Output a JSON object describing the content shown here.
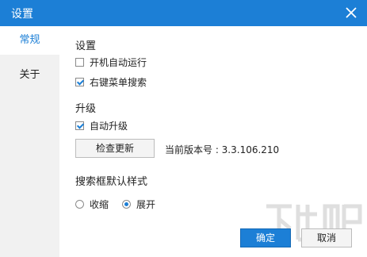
{
  "window": {
    "title": "设置",
    "close_icon": "close-icon"
  },
  "sidebar": {
    "items": [
      {
        "label": "常规",
        "active": true
      },
      {
        "label": "关于",
        "active": false
      }
    ]
  },
  "settings": {
    "heading": "设置",
    "autostart": {
      "label": "开机自动运行",
      "checked": false
    },
    "context_menu": {
      "label": "右键菜单搜索",
      "checked": true
    }
  },
  "upgrade": {
    "heading": "升级",
    "auto_upgrade": {
      "label": "自动升级",
      "checked": true
    },
    "check_button": "检查更新",
    "version_text": "当前版本号 : 3.3.106.210"
  },
  "search_style": {
    "heading": "搜索框默认样式",
    "options": [
      {
        "label": "收缩",
        "selected": false
      },
      {
        "label": "展开",
        "selected": true
      }
    ]
  },
  "footer": {
    "ok_label": "确定",
    "cancel_label": "取消"
  },
  "colors": {
    "accent": "#1c7fd6",
    "sidebar_bg": "#f1f1f1"
  }
}
